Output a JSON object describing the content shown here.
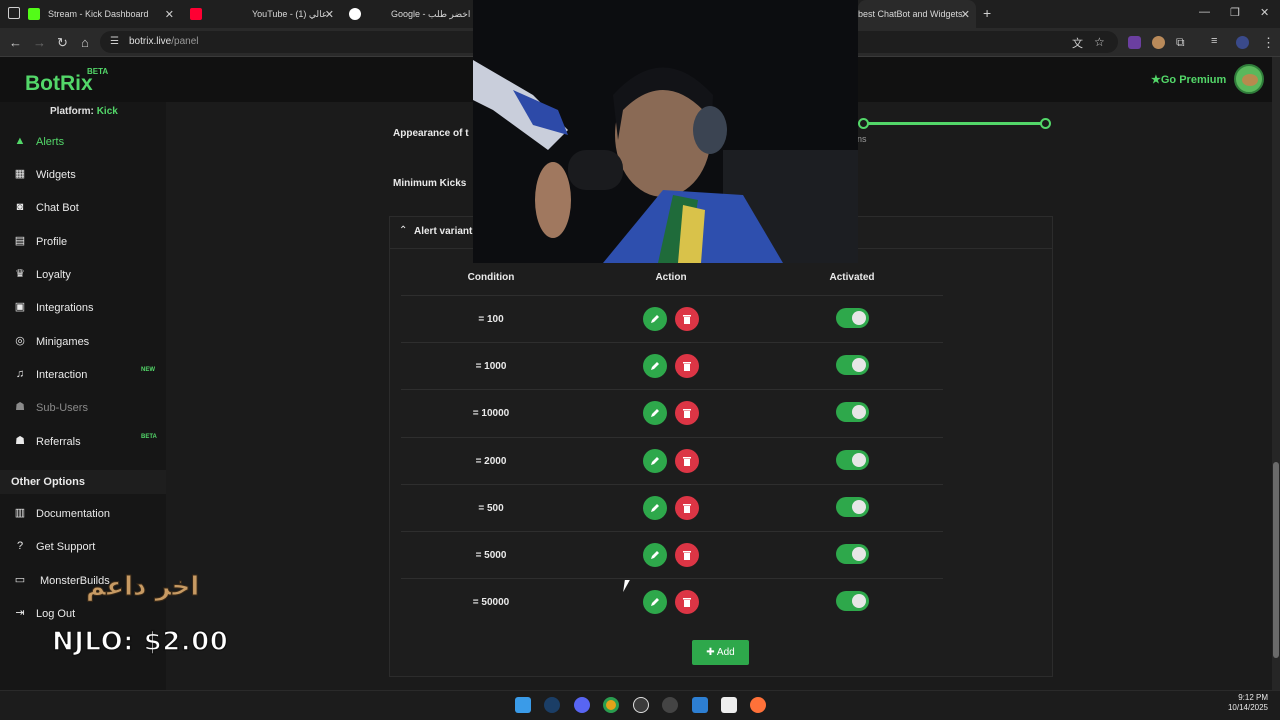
{
  "browser": {
    "tabs": [
      {
        "title": "Stream - Kick Dashboard",
        "favicon": "kick-icon"
      },
      {
        "title": "YouTube - (1) عالي",
        "favicon": "youtube-icon"
      },
      {
        "title": "Google - بحث اخضر طلب",
        "favicon": "google-icon"
      },
      {
        "title": "best ChatBot and Widgets",
        "favicon": "botrix-icon"
      }
    ],
    "url_host": "botrix.live",
    "url_path": "/panel"
  },
  "header": {
    "logo": "BotRix",
    "logo_badge": "BETA",
    "premium_label": "Go Premium"
  },
  "sidebar": {
    "platform_label": "Platform:",
    "platform_value": "Kick",
    "items": [
      {
        "label": "Alerts",
        "icon": "warning-icon"
      },
      {
        "label": "Widgets",
        "icon": "grid-icon"
      },
      {
        "label": "Chat Bot",
        "icon": "robot-icon"
      },
      {
        "label": "Profile",
        "icon": "id-card-icon"
      },
      {
        "label": "Loyalty",
        "icon": "trophy-icon"
      },
      {
        "label": "Integrations",
        "icon": "chat-icon"
      },
      {
        "label": "Minigames",
        "icon": "gamepad-icon"
      },
      {
        "label": "Interaction",
        "icon": "music-icon",
        "badge": "NEW"
      },
      {
        "label": "Sub-Users",
        "icon": "users-icon"
      },
      {
        "label": "Referrals",
        "icon": "people-icon",
        "badge": "BETA"
      }
    ],
    "other_title": "Other Options",
    "other_items": [
      {
        "label": "Documentation",
        "icon": "docs-icon"
      },
      {
        "label": "Get Support",
        "icon": "question-icon"
      },
      {
        "label": "MonsterBuilds",
        "icon": "laptop-icon"
      },
      {
        "label": "Log Out",
        "icon": "logout-icon"
      }
    ]
  },
  "form": {
    "appearance_label": "Appearance of t",
    "slider_text": "ns",
    "min_kicks_label": "Minimum Kicks",
    "panel_title": "Alert variant"
  },
  "table": {
    "headers": [
      "Condition",
      "Action",
      "Activated"
    ],
    "rows": [
      {
        "condition": "= 100",
        "activated": true
      },
      {
        "condition": "= 1000",
        "activated": true
      },
      {
        "condition": "= 10000",
        "activated": true
      },
      {
        "condition": "= 2000",
        "activated": true
      },
      {
        "condition": "= 500",
        "activated": true
      },
      {
        "condition": "= 5000",
        "activated": true
      },
      {
        "condition": "= 50000",
        "activated": true
      }
    ],
    "add_label": "Add"
  },
  "overlay": {
    "last_supporter_ar": "اخر داعم",
    "donation": "NJLO: $2.00"
  },
  "taskbar": {
    "time": "9:12 PM",
    "date": "10/14/2025"
  },
  "colors": {
    "accent": "#53d769",
    "danger": "#dc3545"
  }
}
